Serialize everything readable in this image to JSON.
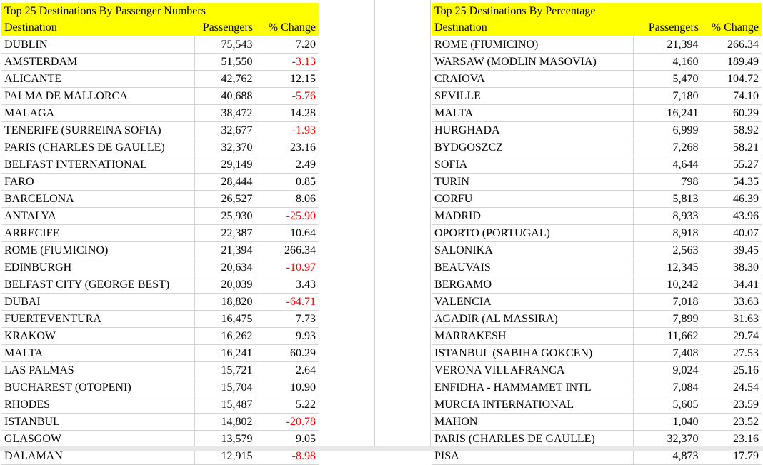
{
  "left_table": {
    "title": "Top 25 Destinations By Passenger Numbers",
    "headers": [
      "Destination",
      "Passengers",
      "% Change"
    ],
    "rows": [
      [
        "DUBLIN",
        "75,543",
        "7.20"
      ],
      [
        "AMSTERDAM",
        "51,550",
        "-3.13"
      ],
      [
        "ALICANTE",
        "42,762",
        "12.15"
      ],
      [
        "PALMA DE MALLORCA",
        "40,688",
        "-5.76"
      ],
      [
        "MALAGA",
        "38,472",
        "14.28"
      ],
      [
        "TENERIFE (SURREINA SOFIA)",
        "32,677",
        "-1.93"
      ],
      [
        "PARIS (CHARLES DE GAULLE)",
        "32,370",
        "23.16"
      ],
      [
        "BELFAST INTERNATIONAL",
        "29,149",
        "2.49"
      ],
      [
        "FARO",
        "28,444",
        "0.85"
      ],
      [
        "BARCELONA",
        "26,527",
        "8.06"
      ],
      [
        "ANTALYA",
        "25,930",
        "-25.90"
      ],
      [
        "ARRECIFE",
        "22,387",
        "10.64"
      ],
      [
        "ROME (FIUMICINO)",
        "21,394",
        "266.34"
      ],
      [
        "EDINBURGH",
        "20,634",
        "-10.97"
      ],
      [
        "BELFAST CITY (GEORGE BEST)",
        "20,039",
        "3.43"
      ],
      [
        "DUBAI",
        "18,820",
        "-64.71"
      ],
      [
        "FUERTEVENTURA",
        "16,475",
        "7.73"
      ],
      [
        "KRAKOW",
        "16,262",
        "9.93"
      ],
      [
        "MALTA",
        "16,241",
        "60.29"
      ],
      [
        "LAS PALMAS",
        "15,721",
        "2.64"
      ],
      [
        "BUCHAREST (OTOPENI)",
        "15,704",
        "10.90"
      ],
      [
        "RHODES",
        "15,487",
        "5.22"
      ],
      [
        "ISTANBUL",
        "14,802",
        "-20.78"
      ],
      [
        "GLASGOW",
        "13,579",
        "9.05"
      ],
      [
        "DALAMAN",
        "12,915",
        "-8.98"
      ]
    ]
  },
  "right_table": {
    "title": "Top 25 Destinations By Percentage",
    "headers": [
      "Destination",
      "Passengers",
      "% Change"
    ],
    "rows": [
      [
        "ROME (FIUMICINO)",
        "21,394",
        "266.34"
      ],
      [
        "WARSAW (MODLIN MASOVIA)",
        "4,160",
        "189.49"
      ],
      [
        "CRAIOVA",
        "5,470",
        "104.72"
      ],
      [
        "SEVILLE",
        "7,180",
        "74.10"
      ],
      [
        "MALTA",
        "16,241",
        "60.29"
      ],
      [
        "HURGHADA",
        "6,999",
        "58.92"
      ],
      [
        "BYDGOSZCZ",
        "7,268",
        "58.21"
      ],
      [
        "SOFIA",
        "4,644",
        "55.27"
      ],
      [
        "TURIN",
        "798",
        "54.35"
      ],
      [
        "CORFU",
        "5,813",
        "46.39"
      ],
      [
        "MADRID",
        "8,933",
        "43.96"
      ],
      [
        "OPORTO (PORTUGAL)",
        "8,918",
        "40.07"
      ],
      [
        "SALONIKA",
        "2,563",
        "39.45"
      ],
      [
        "BEAUVAIS",
        "12,345",
        "38.30"
      ],
      [
        "BERGAMO",
        "10,242",
        "34.41"
      ],
      [
        "VALENCIA",
        "7,018",
        "33.63"
      ],
      [
        "AGADIR (AL MASSIRA)",
        "7,899",
        "31.63"
      ],
      [
        "MARRAKESH",
        "11,662",
        "29.74"
      ],
      [
        "ISTANBUL (SABIHA GOKCEN)",
        "7,408",
        "27.53"
      ],
      [
        "VERONA VILLAFRANCA",
        "9,024",
        "25.16"
      ],
      [
        "ENFIDHA - HAMMAMET INTL",
        "7,084",
        "24.54"
      ],
      [
        "MURCIA INTERNATIONAL",
        "5,605",
        "23.59"
      ],
      [
        "MAHON",
        "1,040",
        "23.52"
      ],
      [
        "PARIS (CHARLES DE GAULLE)",
        "32,370",
        "23.16"
      ],
      [
        "PISA",
        "4,873",
        "17.79"
      ]
    ]
  },
  "colors": {
    "header_fill": "#ffff00",
    "negative": "#ff0000",
    "gridline": "#d4d4d4"
  }
}
